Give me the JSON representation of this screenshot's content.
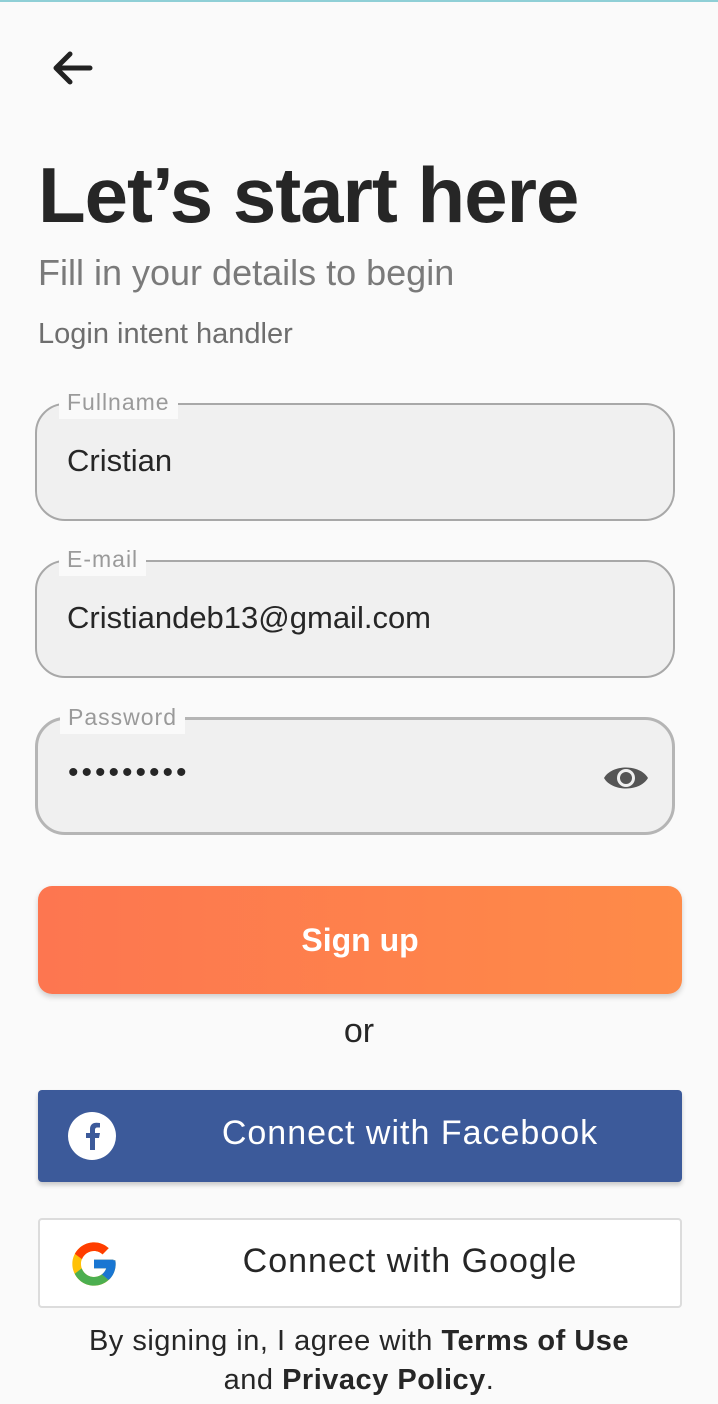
{
  "header": {
    "back_icon": "arrow-left-icon",
    "title": "Let’s start here",
    "subtitle": "Fill in your details to begin",
    "intent_text": "Login intent handler"
  },
  "form": {
    "fullname": {
      "label": "Fullname",
      "value": "Cristian"
    },
    "email": {
      "label": "E-mail",
      "value": "Cristiandeb13@gmail.com"
    },
    "password": {
      "label": "Password",
      "value": "•••••••••",
      "toggle_icon": "eye-icon"
    }
  },
  "actions": {
    "signup_label": "Sign up",
    "or_text": "or",
    "facebook_label": "Connect with Facebook",
    "google_label": "Connect with Google"
  },
  "legal": {
    "prefix": "By signing in, I agree with ",
    "terms_link": "Terms of Use",
    "middle": "and ",
    "privacy_link": "Privacy Policy",
    "suffix": "."
  },
  "colors": {
    "accent_start": "#fd7650",
    "accent_end": "#fe8b48",
    "facebook_blue": "#3c5a9a",
    "background": "#fafafa"
  }
}
